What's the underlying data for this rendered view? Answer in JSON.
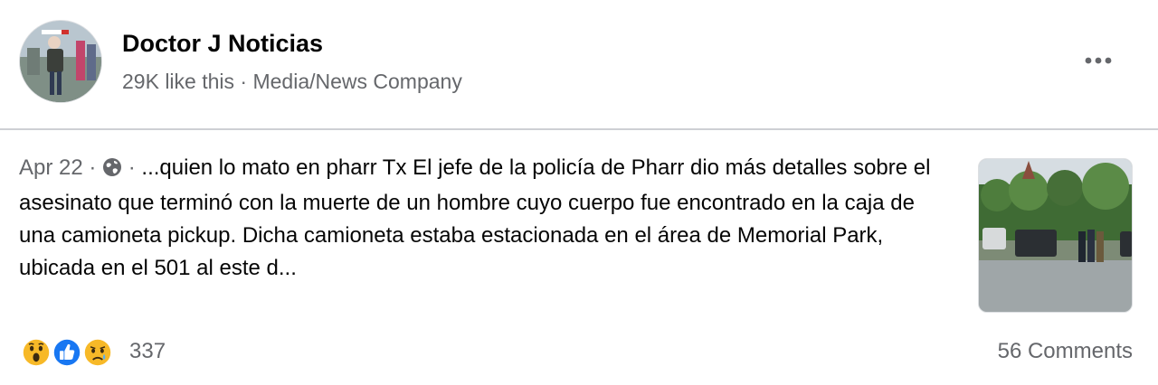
{
  "header": {
    "page_name": "Doctor J Noticias",
    "likes": "29K like this",
    "separator": "·",
    "category": "Media/News Company",
    "avatar_icon": "page-avatar-photo",
    "more_icon": "more-options-icon"
  },
  "post": {
    "date": "Apr 22",
    "sep1": "·",
    "privacy_icon": "globe-icon",
    "sep2": "·",
    "text": "...quien lo mato en pharr Tx El jefe de la policía de Pharr dio más detalles sobre el asesinato que terminó con la muerte de un hombre cuyo cuerpo fue encontrado en la caja de una camioneta pickup. Dicha camioneta estaba estacionada en el área de Memorial Park, ubicada en el 501 al este d...",
    "thumbnail_icon": "news-photo-thumbnail"
  },
  "footer": {
    "reactions": [
      "wow",
      "like",
      "sad"
    ],
    "reaction_count": "337",
    "comments": "56 Comments"
  },
  "colors": {
    "primary_text": "#050505",
    "secondary_text": "#65676b",
    "like_blue": "#1877f2",
    "divider": "#ced0d4"
  }
}
